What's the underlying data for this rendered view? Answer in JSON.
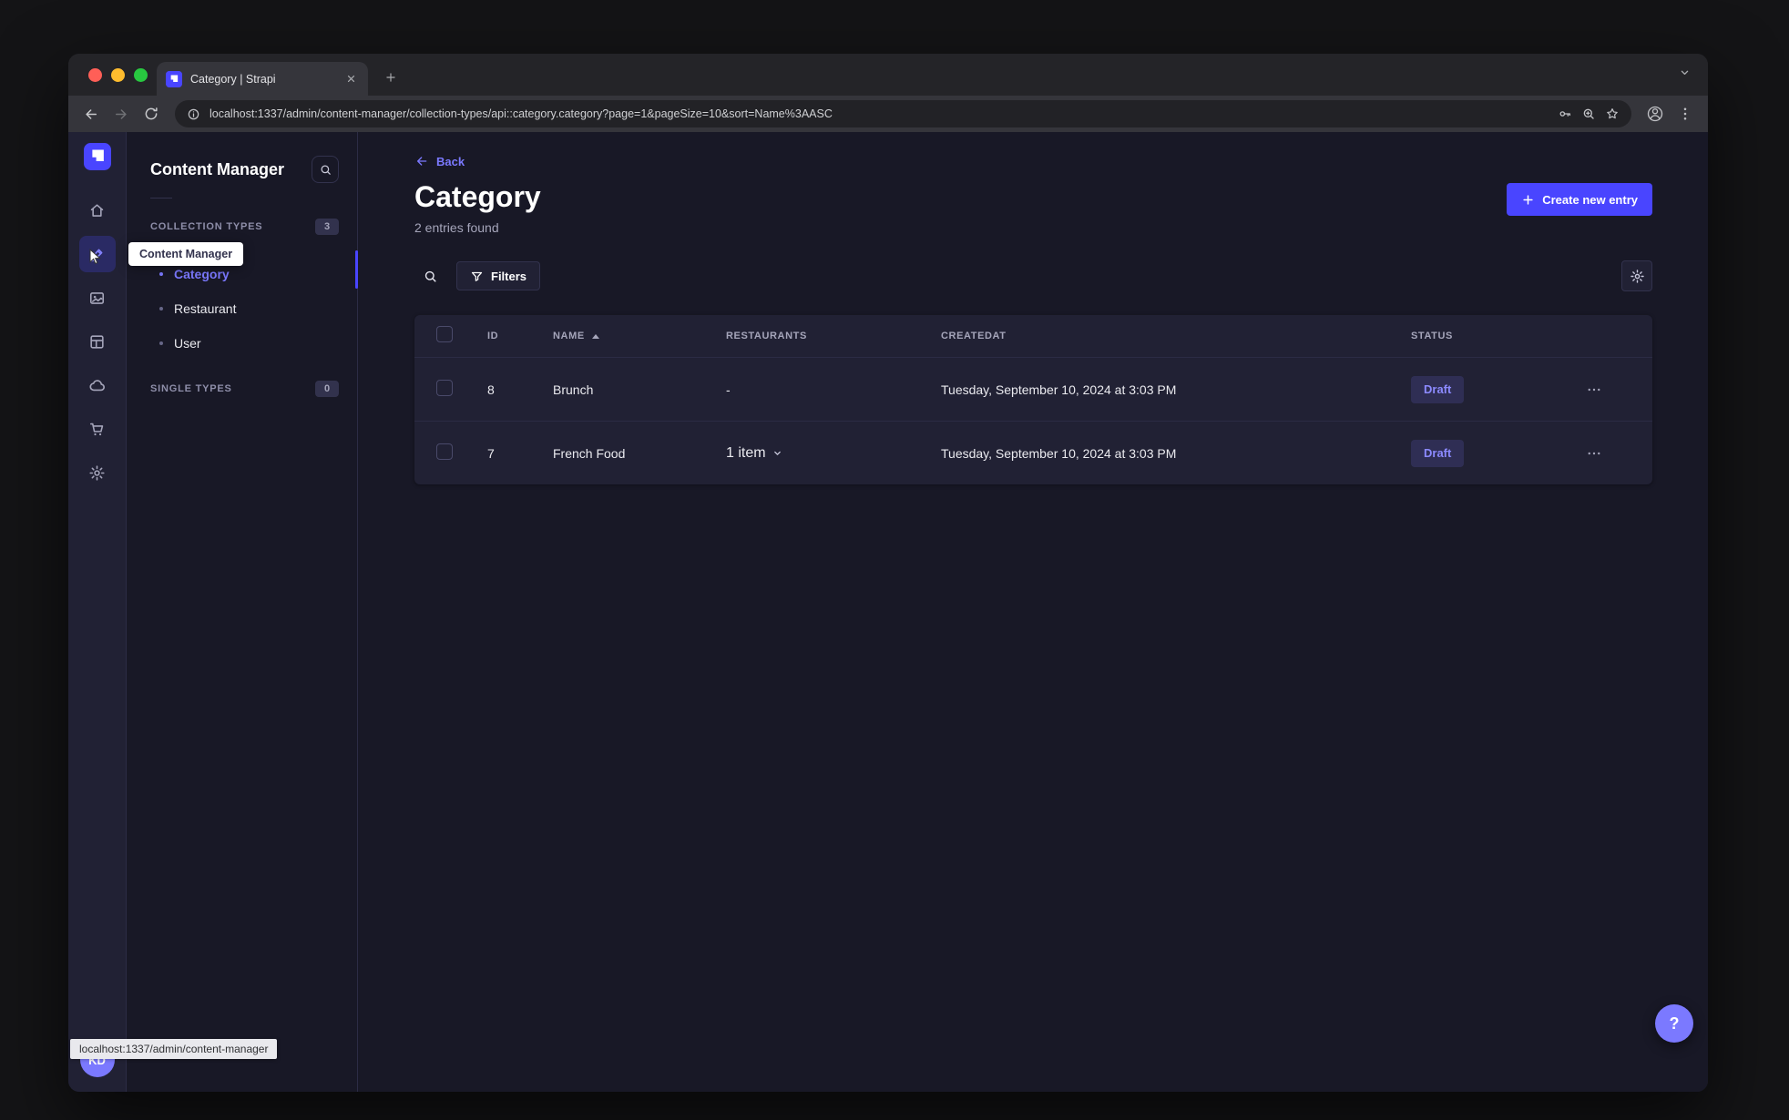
{
  "browser": {
    "tab_title": "Category | Strapi",
    "url": "localhost:1337/admin/content-manager/collection-types/api::category.category?page=1&pageSize=10&sort=Name%3AASC",
    "status_bubble": "localhost:1337/admin/content-manager"
  },
  "rail": {
    "tooltip": "Content Manager",
    "avatar_initials": "KD"
  },
  "subnav": {
    "title": "Content Manager",
    "collection_types_label": "COLLECTION TYPES",
    "collection_types_count": "3",
    "items": [
      {
        "label": "Category"
      },
      {
        "label": "Restaurant"
      },
      {
        "label": "User"
      }
    ],
    "single_types_label": "SINGLE TYPES",
    "single_types_count": "0"
  },
  "main": {
    "back_label": "Back",
    "title": "Category",
    "subtitle": "2 entries found",
    "create_button_label": "Create new entry",
    "filters_label": "Filters",
    "help_label": "?",
    "table": {
      "headers": {
        "id": "ID",
        "name": "NAME",
        "restaurants": "RESTAURANTS",
        "createdat": "CREATEDAT",
        "status": "STATUS"
      },
      "rows": [
        {
          "id": "8",
          "name": "Brunch",
          "restaurants": "-",
          "createdat": "Tuesday, September 10, 2024 at 3:03 PM",
          "status": "Draft"
        },
        {
          "id": "7",
          "name": "French Food",
          "restaurants": "1 item",
          "createdat": "Tuesday, September 10, 2024 at 3:03 PM",
          "status": "Draft"
        }
      ]
    }
  },
  "colors": {
    "primary": "#4945ff",
    "link": "#7b79ff",
    "app_background": "#181826",
    "surface": "#212134",
    "border": "#32324d"
  }
}
